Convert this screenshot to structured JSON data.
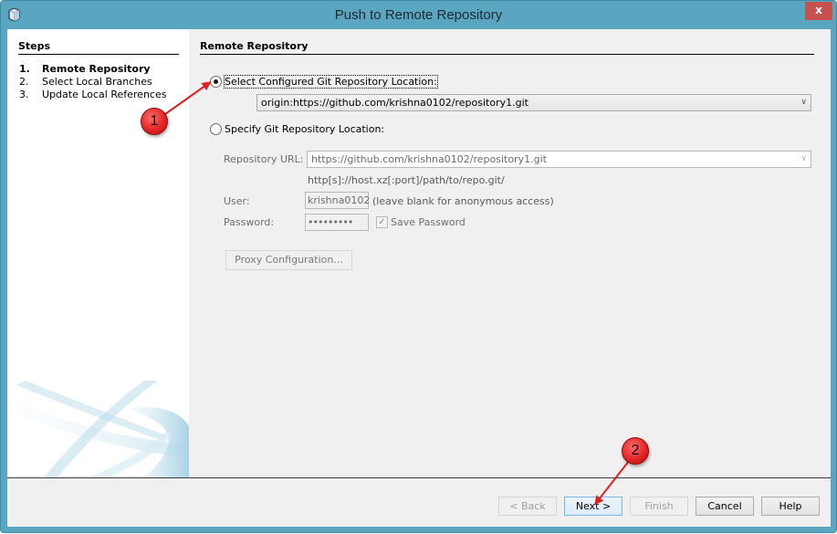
{
  "window": {
    "title": "Push to Remote Repository",
    "close_label": "x",
    "accent_color": "#5aa5bf"
  },
  "steps": {
    "header": "Steps",
    "items": [
      {
        "num": "1.",
        "label": "Remote Repository",
        "active": true
      },
      {
        "num": "2.",
        "label": "Select Local Branches",
        "active": false
      },
      {
        "num": "3.",
        "label": "Update Local References",
        "active": false
      }
    ]
  },
  "content": {
    "header": "Remote Repository",
    "option_configured": {
      "label": "Select Configured Git Repository Location:",
      "selected": true,
      "combo_value": "origin:https://github.com/krishna0102/repository1.git"
    },
    "option_specify": {
      "label": "Specify Git Repository Location:",
      "selected": false,
      "url_label": "Repository URL:",
      "url_value": "https://github.com/krishna0102/repository1.git",
      "url_hint": "http[s]://host.xz[:port]/path/to/repo.git/",
      "user_label": "User:",
      "user_value": "krishna0102",
      "user_hint": "(leave blank for anonymous access)",
      "password_label": "Password:",
      "password_value": "•••••••••",
      "save_password_label": "Save Password",
      "save_password_checked": true,
      "proxy_button": "Proxy Configuration..."
    }
  },
  "buttons": {
    "back": "< Back",
    "next": "Next >",
    "finish": "Finish",
    "cancel": "Cancel",
    "help": "Help"
  },
  "annotations": {
    "callout_1": "1",
    "callout_2": "2",
    "color": "#e02020"
  }
}
